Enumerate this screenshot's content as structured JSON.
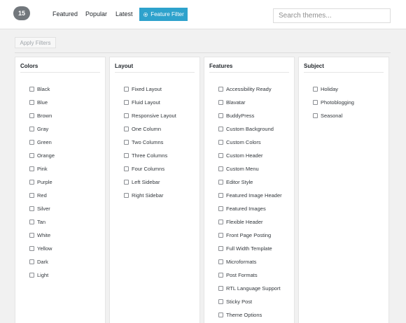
{
  "toolbar": {
    "count": "15",
    "tabs": [
      "Featured",
      "Popular",
      "Latest"
    ],
    "feature_filter_label": "Feature Filter",
    "search_placeholder": "Search themes..."
  },
  "filters": {
    "apply_label": "Apply Filters",
    "groups": [
      {
        "title": "Colors",
        "options": [
          "Black",
          "Blue",
          "Brown",
          "Gray",
          "Green",
          "Orange",
          "Pink",
          "Purple",
          "Red",
          "Silver",
          "Tan",
          "White",
          "Yellow",
          "Dark",
          "Light"
        ]
      },
      {
        "title": "Layout",
        "options": [
          "Fixed Layout",
          "Fluid Layout",
          "Responsive Layout",
          "One Column",
          "Two Columns",
          "Three Columns",
          "Four Columns",
          "Left Sidebar",
          "Right Sidebar"
        ]
      },
      {
        "title": "Features",
        "options": [
          "Accessibility Ready",
          "Blavatar",
          "BuddyPress",
          "Custom Background",
          "Custom Colors",
          "Custom Header",
          "Custom Menu",
          "Editor Style",
          "Featured Image Header",
          "Featured Images",
          "Flexible Header",
          "Front Page Posting",
          "Full Width Template",
          "Microformats",
          "Post Formats",
          "RTL Language Support",
          "Sticky Post",
          "Theme Options"
        ]
      },
      {
        "title": "Subject",
        "options": [
          "Holiday",
          "Photoblogging",
          "Seasonal"
        ]
      }
    ]
  },
  "colors": {
    "accent": "#2ea2cc",
    "badge": "#72777c",
    "panel_bg": "#ffffff",
    "page_bg": "#f1f1f1"
  }
}
